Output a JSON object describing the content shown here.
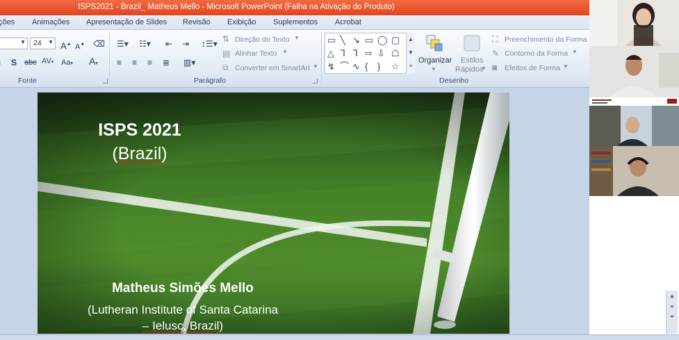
{
  "window": {
    "title": "ISPS2021 - Brazil_ Matheus Mello  -  Microsoft PowerPoint (Falha na Ativação do Produto)"
  },
  "tabs": [
    "ções",
    "Animações",
    "Apresentação de Slides",
    "Revisão",
    "Exibição",
    "Suplementos",
    "Acrobat"
  ],
  "ribbon": {
    "font_size": "24",
    "groups": {
      "fonte": "Fonte",
      "paragrafo": "Parágrafo",
      "desenho": "Desenho"
    },
    "paragraph": {
      "direcao_texto": "Direção do Texto",
      "alinhar_texto": "Alinhar Texto",
      "converter_smartart": "Converter em SmartArt"
    },
    "drawing": {
      "organizar": "Organizar",
      "estilos": "Estilos",
      "rapidos": "Rápidos",
      "preenchimento": "Preenchimento da Forma",
      "contorno": "Contorno da Forma",
      "efeitos": "Efeitos de Forma"
    },
    "font_glyphs": {
      "grow": "A",
      "shrink": "A",
      "strike": "abc",
      "spacing": "AV",
      "case": "Aa",
      "color": "A",
      "shadow": "S"
    }
  },
  "slide": {
    "title": "ISPS 2021",
    "subtitle": "(Brazil)",
    "name": "Matheus Simões Mello",
    "institution_line1": "(Lutheran Institute of Santa Catarina",
    "institution_line2": "– Ielusc, Brazil)"
  },
  "video_tiles": [
    {
      "participant": "participant-1"
    },
    {
      "participant": "participant-2"
    },
    {
      "participant": "participant-3"
    },
    {
      "participant": "participant-4"
    }
  ],
  "colors": {
    "titlebar": "#e4522b",
    "grass": "#3b7a2a",
    "ribbon": "#e3ebf5"
  }
}
